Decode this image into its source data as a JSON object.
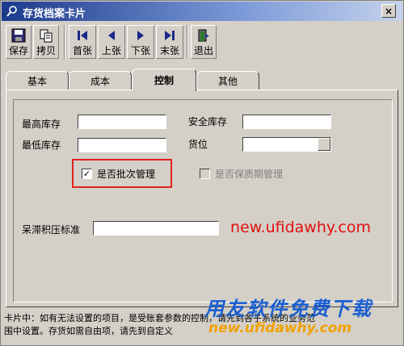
{
  "window": {
    "title": "存货档案卡片",
    "close_label": "×"
  },
  "toolbar": {
    "items": [
      {
        "label": "保存",
        "icon": "save-icon"
      },
      {
        "label": "拷贝",
        "icon": "copy-icon"
      },
      {
        "label": "首张",
        "icon": "first-icon"
      },
      {
        "label": "上张",
        "icon": "prev-icon"
      },
      {
        "label": "下张",
        "icon": "next-icon"
      },
      {
        "label": "末张",
        "icon": "last-icon"
      },
      {
        "label": "退出",
        "icon": "exit-icon"
      }
    ]
  },
  "tabs": [
    {
      "label": "基本",
      "active": false
    },
    {
      "label": "成本",
      "active": false
    },
    {
      "label": "控制",
      "active": true
    },
    {
      "label": "其他",
      "active": false
    }
  ],
  "form": {
    "max_stock_label": "最高库存",
    "min_stock_label": "最低库存",
    "safety_stock_label": "安全库存",
    "location_label": "货位",
    "batch_label": "是否批次管理",
    "batch_checked": true,
    "shelf_life_label": "是否保质期管理",
    "shelf_life_checked": false,
    "slow_moving_label": "呆滞积压标准",
    "check_mark": "✓"
  },
  "watermark": {
    "url": "new.ufidawhy.com",
    "brand": "用友软件免费下载",
    "brand_url": "new.ufidawhy.com"
  },
  "footer": {
    "line1": "卡片中：如有无法设置的项目，是受账套参数的控制，请先到各子系统的业务范",
    "line2": "围中设置。存货如需自由项，请先到自定义"
  },
  "colors": {
    "accent_red": "#e02020",
    "brand_blue": "#1a5fd0",
    "brand_orange": "#f2a100"
  }
}
